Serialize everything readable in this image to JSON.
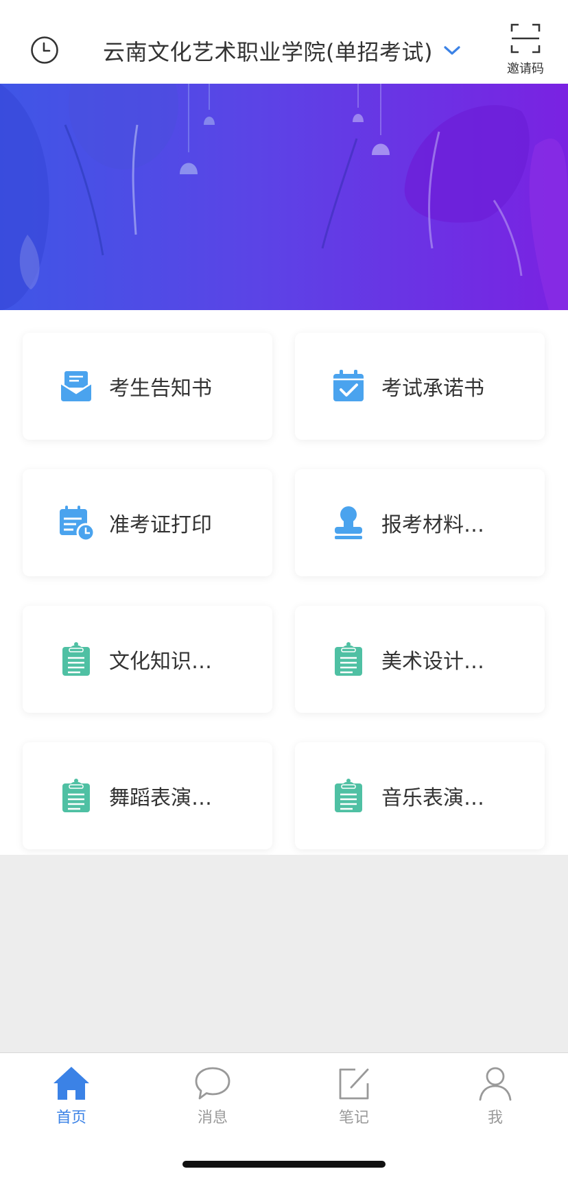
{
  "header": {
    "title": "云南文化艺术职业学院(单招考试)",
    "invite_label": "邀请码"
  },
  "cards": [
    {
      "label": "考生告知书",
      "icon": "envelope-icon"
    },
    {
      "label": "考试承诺书",
      "icon": "calendar-check-icon"
    },
    {
      "label": "准考证打印",
      "icon": "calendar-clock-icon"
    },
    {
      "label": "报考材料上传",
      "icon": "stamp-icon"
    },
    {
      "label": "文化知识考试",
      "icon": "clipboard-icon"
    },
    {
      "label": "美术设计类…",
      "icon": "clipboard-icon"
    },
    {
      "label": "舞蹈表演考试",
      "icon": "clipboard-icon"
    },
    {
      "label": "音乐表演考试",
      "icon": "clipboard-icon"
    }
  ],
  "tabbar": {
    "items": [
      {
        "label": "首页",
        "icon": "home-icon",
        "active": true
      },
      {
        "label": "消息",
        "icon": "chat-bubble-icon",
        "active": false
      },
      {
        "label": "笔记",
        "icon": "edit-note-icon",
        "active": false
      },
      {
        "label": "我",
        "icon": "user-icon",
        "active": false
      }
    ]
  },
  "colors": {
    "accent": "#3b82e6",
    "icon_blue": "#4aa3ee",
    "icon_green": "#4fc0a3",
    "banner_start": "#3f56e6",
    "banner_end": "#7a22e2"
  }
}
